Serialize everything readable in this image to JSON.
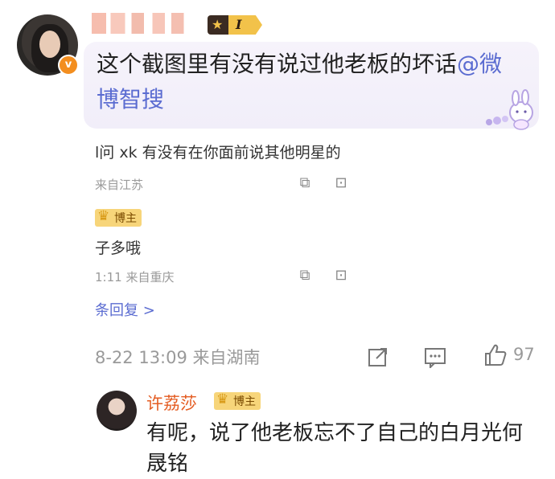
{
  "top_comment": {
    "level_badge": "I",
    "text_main": "这个截图里有没有说过他老板的坏话",
    "mention": "@微博智搜",
    "verified_mark": "v"
  },
  "quoted_thread": {
    "line1": "l问 xk 有没有在你面前说其他明星的",
    "meta1_location": "来自江苏",
    "reply_name_tag": "博主",
    "line2": "子多哦",
    "meta2": "1:11  来自重庆",
    "more_replies": "条回复 >"
  },
  "main_meta": {
    "timestamp_location": "8-22 13:09  来自湖南",
    "like_count": "97"
  },
  "reply": {
    "username": "许荔莎",
    "tag": "博主",
    "text": "有呢，说了他老板忘不了自己的白月光何晟铭"
  },
  "colors": {
    "accent_link": "#5b6cd1",
    "username_orange": "#e45c22",
    "badge_gold": "#f7d57a",
    "meta_gray": "#9a9a9a"
  }
}
